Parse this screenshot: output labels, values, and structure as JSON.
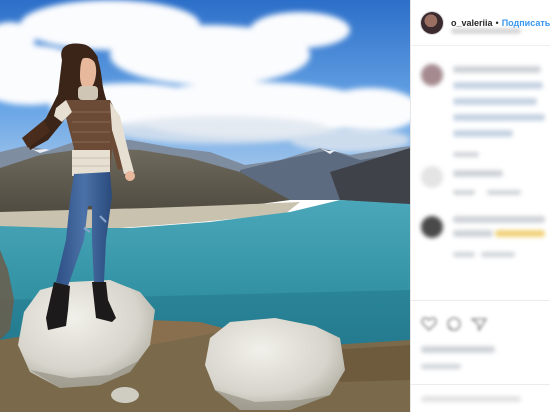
{
  "post": {
    "username": "o_valeriia",
    "separator": "•",
    "follow_label": "Подписаться"
  },
  "photo": {
    "alt": "Girl standing on a rock above a turquoise mountain lake"
  },
  "colors": {
    "link": "#3897f0",
    "username": "#262626",
    "lake": "#2f8fa0",
    "sky": "#3f86d9"
  },
  "icons": [
    "like-icon",
    "comment-icon",
    "share-icon"
  ]
}
